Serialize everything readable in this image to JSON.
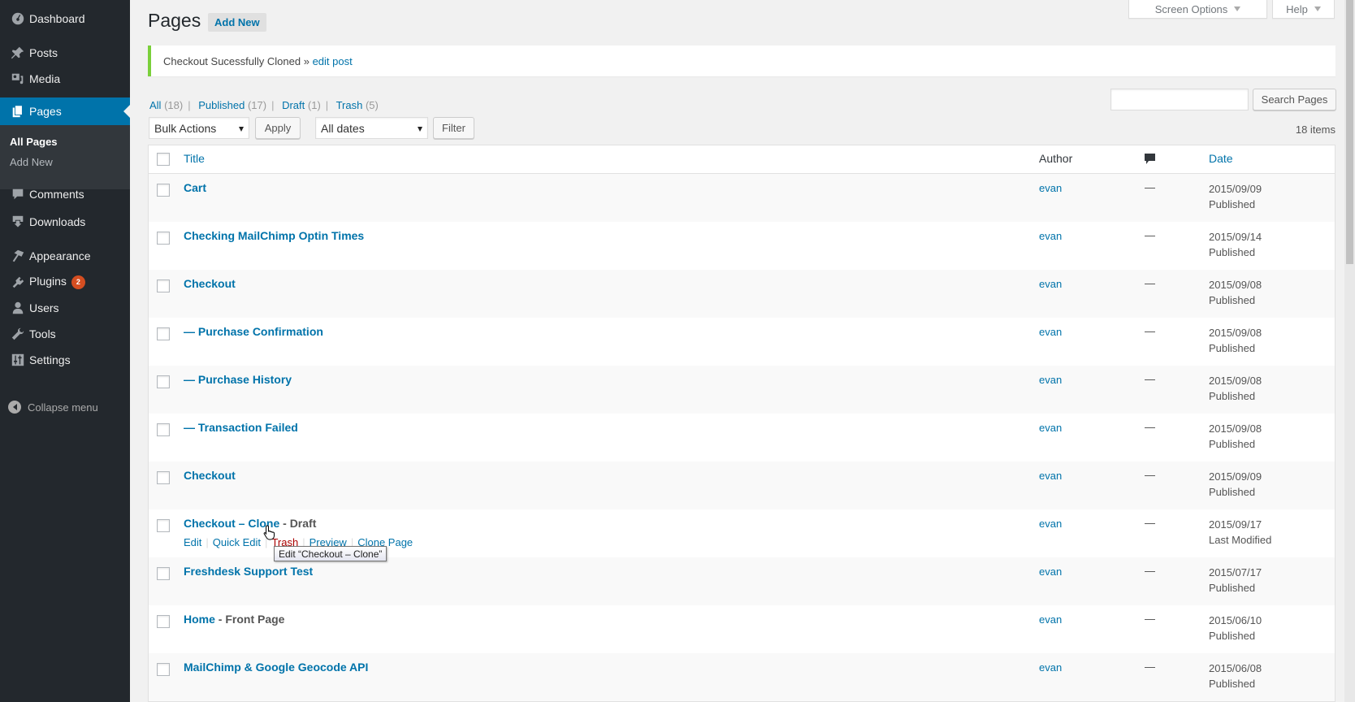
{
  "sidebar": {
    "items": [
      {
        "label": "Dashboard",
        "icon": "dashboard-icon"
      },
      {
        "label": "Posts",
        "icon": "pin-icon"
      },
      {
        "label": "Media",
        "icon": "media-icon"
      },
      {
        "label": "Pages",
        "icon": "pages-icon",
        "current": true
      },
      {
        "label": "Comments",
        "icon": "comment-icon"
      },
      {
        "label": "Downloads",
        "icon": "download-icon"
      },
      {
        "label": "Appearance",
        "icon": "paintbrush-icon"
      },
      {
        "label": "Plugins",
        "icon": "plugin-icon",
        "badge": "2"
      },
      {
        "label": "Users",
        "icon": "user-icon"
      },
      {
        "label": "Tools",
        "icon": "wrench-icon"
      },
      {
        "label": "Settings",
        "icon": "settings-icon"
      }
    ],
    "submenu": [
      {
        "label": "All Pages",
        "current": true
      },
      {
        "label": "Add New"
      }
    ],
    "collapse_label": "Collapse menu"
  },
  "screen_meta": {
    "screen_options": "Screen Options",
    "help": "Help"
  },
  "header": {
    "title": "Pages",
    "add_new": "Add New"
  },
  "notice": {
    "text": "Checkout Sucessfully Cloned » ",
    "link": "edit post",
    "accent": "#7ad03a"
  },
  "filters": {
    "views": [
      {
        "label": "All",
        "count": "(18)"
      },
      {
        "label": "Published",
        "count": "(17)"
      },
      {
        "label": "Draft",
        "count": "(1)"
      },
      {
        "label": "Trash",
        "count": "(5)"
      }
    ],
    "bulk_actions": "Bulk Actions",
    "apply": "Apply",
    "dates": "All dates",
    "filter": "Filter",
    "search_value": "",
    "search_button": "Search Pages",
    "items_count": "18 items"
  },
  "table": {
    "columns": {
      "title": "Title",
      "author": "Author",
      "comments": "comment-icon",
      "date": "Date"
    },
    "rows": [
      {
        "title": "Cart",
        "state": "",
        "author": "evan",
        "comments": "—",
        "date": "2015/09/09",
        "status": "Published"
      },
      {
        "title": "Checking MailChimp Optin Times",
        "state": "",
        "author": "evan",
        "comments": "—",
        "date": "2015/09/14",
        "status": "Published"
      },
      {
        "title": "Checkout",
        "state": "",
        "author": "evan",
        "comments": "—",
        "date": "2015/09/08",
        "status": "Published"
      },
      {
        "title": "— Purchase Confirmation",
        "state": "",
        "author": "evan",
        "comments": "—",
        "date": "2015/09/08",
        "status": "Published"
      },
      {
        "title": "— Purchase History",
        "state": "",
        "author": "evan",
        "comments": "—",
        "date": "2015/09/08",
        "status": "Published"
      },
      {
        "title": "— Transaction Failed",
        "state": "",
        "author": "evan",
        "comments": "—",
        "date": "2015/09/08",
        "status": "Published"
      },
      {
        "title": "Checkout",
        "state": "",
        "author": "evan",
        "comments": "—",
        "date": "2015/09/09",
        "status": "Published"
      },
      {
        "title": "Checkout – Clone",
        "state": " - Draft",
        "author": "evan",
        "comments": "—",
        "date": "2015/09/17",
        "status": "Last Modified"
      },
      {
        "title": "Freshdesk Support Test",
        "state": "",
        "author": "evan",
        "comments": "—",
        "date": "2015/07/17",
        "status": "Published"
      },
      {
        "title": "Home",
        "state": " - Front Page",
        "author": "evan",
        "comments": "—",
        "date": "2015/06/10",
        "status": "Published"
      },
      {
        "title": "MailChimp & Google Geocode API",
        "state": "",
        "author": "evan",
        "comments": "—",
        "date": "2015/06/08",
        "status": "Published"
      }
    ],
    "hover_row_actions": [
      "Edit",
      "Quick Edit",
      "Trash",
      "Preview",
      "Clone Page"
    ],
    "tooltip": "Edit “Checkout – Clone”"
  }
}
